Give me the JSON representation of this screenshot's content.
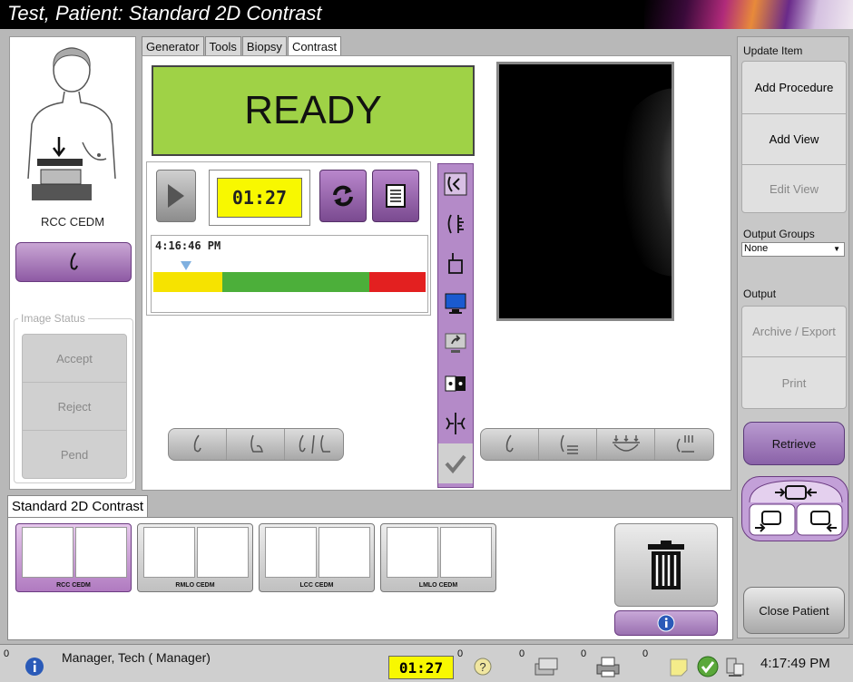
{
  "window": {
    "title": "Test, Patient:  Standard 2D Contrast"
  },
  "left_panel": {
    "view_label": "RCC CEDM",
    "image_status_legend": "Image Status",
    "status_buttons": [
      "Accept",
      "Reject",
      "Pend"
    ]
  },
  "tabs": [
    {
      "label": "Generator"
    },
    {
      "label": "Tools"
    },
    {
      "label": "Biopsy"
    },
    {
      "label": "Contrast",
      "active": true
    }
  ],
  "contrast": {
    "ready_text": "READY",
    "timer_value": "01:27",
    "time_readout": "4:16:46 PM",
    "progress_fraction": 0.12
  },
  "right_panel": {
    "update_item_label": "Update Item",
    "add_procedure": "Add Procedure",
    "add_view": "Add View",
    "edit_view": "Edit View",
    "output_groups_label": "Output Groups",
    "output_groups_value": "None",
    "output_label": "Output",
    "archive_export": "Archive / Export",
    "print": "Print",
    "retrieve": "Retrieve",
    "close_patient": "Close Patient"
  },
  "procedure": {
    "tab_label": "Standard 2D Contrast",
    "thumbnails": [
      {
        "caption": "RCC CEDM",
        "selected": true
      },
      {
        "caption": "RMLO CEDM",
        "selected": false
      },
      {
        "caption": "LCC CEDM",
        "selected": false
      },
      {
        "caption": "LMLO CEDM",
        "selected": false
      }
    ]
  },
  "statusbar": {
    "alarm_count": "0",
    "user": "Manager, Tech ( Manager)",
    "timer": "01:27",
    "count_1": "0",
    "count_2": "0",
    "count_3": "0",
    "count_4": "0",
    "clock": "4:17:49 PM"
  },
  "colors": {
    "accent_purple": "#9a6ab4",
    "ready_green": "#9fd246",
    "timer_yellow": "#f8f800"
  }
}
